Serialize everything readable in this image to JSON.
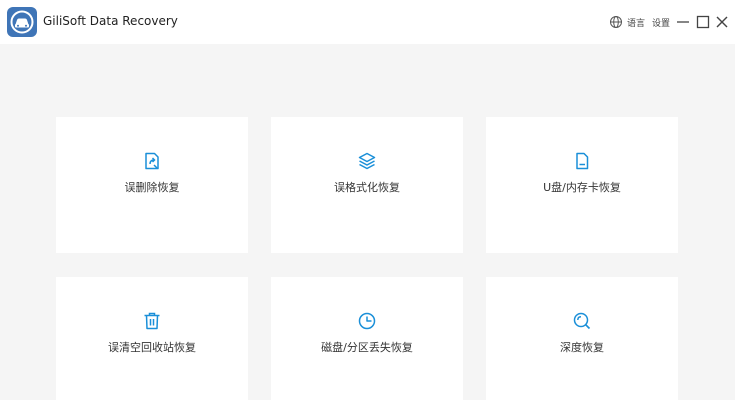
{
  "app": {
    "title": "GiliSoft Data Recovery",
    "logo_icon": "car-recovery-logo",
    "brand_color": "#3f75b7"
  },
  "titlebar": {
    "language_label": "语言",
    "settings_label": "设置",
    "icons": [
      "globe-icon",
      "minimize-icon",
      "maximize-icon",
      "close-icon"
    ]
  },
  "accent_color": "#1a8fd8",
  "modes": [
    {
      "label": "误删除恢复",
      "icon": "file-restore-icon"
    },
    {
      "label": "误格式化恢复",
      "icon": "layers-icon"
    },
    {
      "label": "U盘/内存卡恢复",
      "icon": "sd-card-icon"
    },
    {
      "label": "误清空回收站恢复",
      "icon": "trash-icon"
    },
    {
      "label": "磁盘/分区丢失恢复",
      "icon": "pie-chart-icon"
    },
    {
      "label": "深度恢复",
      "icon": "magnifier-icon"
    }
  ]
}
